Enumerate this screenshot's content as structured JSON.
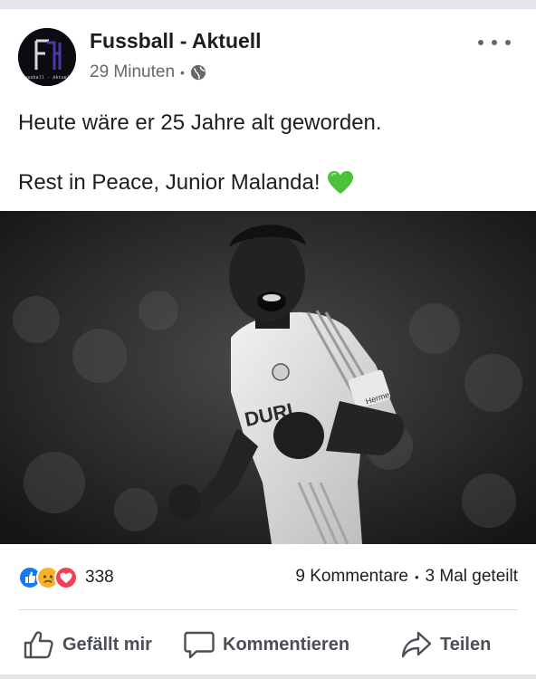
{
  "post": {
    "page_name": "Fussball - Aktuell",
    "avatar_text": "Fussball - Aktuell",
    "avatar_monogram": "FA",
    "timestamp": "29 Minuten",
    "separator": "•",
    "audience_icon": "globe-icon",
    "more_icon": "more-options-icon",
    "text_line_1": "Heute wäre er 25 Jahre alt geworden.",
    "text_line_2": "Rest in Peace, Junior Malanda!",
    "text_emoji": "green-heart-emoji",
    "photo": {
      "description_icon": "football-player-celebrating-photo",
      "shirt_sponsor": "Hermes",
      "shirt_text": "DURL"
    }
  },
  "engagement": {
    "reaction_icons": [
      "like-reaction-icon",
      "sad-reaction-icon",
      "love-reaction-icon"
    ],
    "reaction_count": "338",
    "comments": "9 Kommentare",
    "separator": "•",
    "shares": "3 Mal geteilt"
  },
  "actions": {
    "like_label": "Gefällt mir",
    "comment_label": "Kommentieren",
    "share_label": "Teilen"
  },
  "colors": {
    "like_blue": "#1877f2",
    "love_red": "#f33e58",
    "sad_yellow": "#f7b125",
    "heart_green": "#4cc23a",
    "secondary_text": "#65676b"
  }
}
